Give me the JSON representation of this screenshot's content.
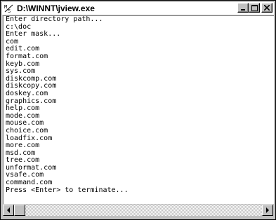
{
  "window": {
    "title": "D:\\WINNT\\jview.exe"
  },
  "console": {
    "lines": [
      "Enter directory path...",
      "c:\\doc",
      "Enter mask...",
      "com",
      "edit.com",
      "format.com",
      "keyb.com",
      "sys.com",
      "diskcomp.com",
      "diskcopy.com",
      "doskey.com",
      "graphics.com",
      "help.com",
      "mode.com",
      "mouse.com",
      "choice.com",
      "loadfix.com",
      "more.com",
      "msd.com",
      "tree.com",
      "unformat.com",
      "vsafe.com",
      "command.com",
      "Press <Enter> to terminate..."
    ]
  },
  "icons": {
    "app": "app-icon",
    "minimize": "minimize-icon",
    "maximize": "maximize-icon",
    "close": "close-icon",
    "scroll_left": "arrow-left-icon",
    "scroll_right": "arrow-right-icon"
  }
}
